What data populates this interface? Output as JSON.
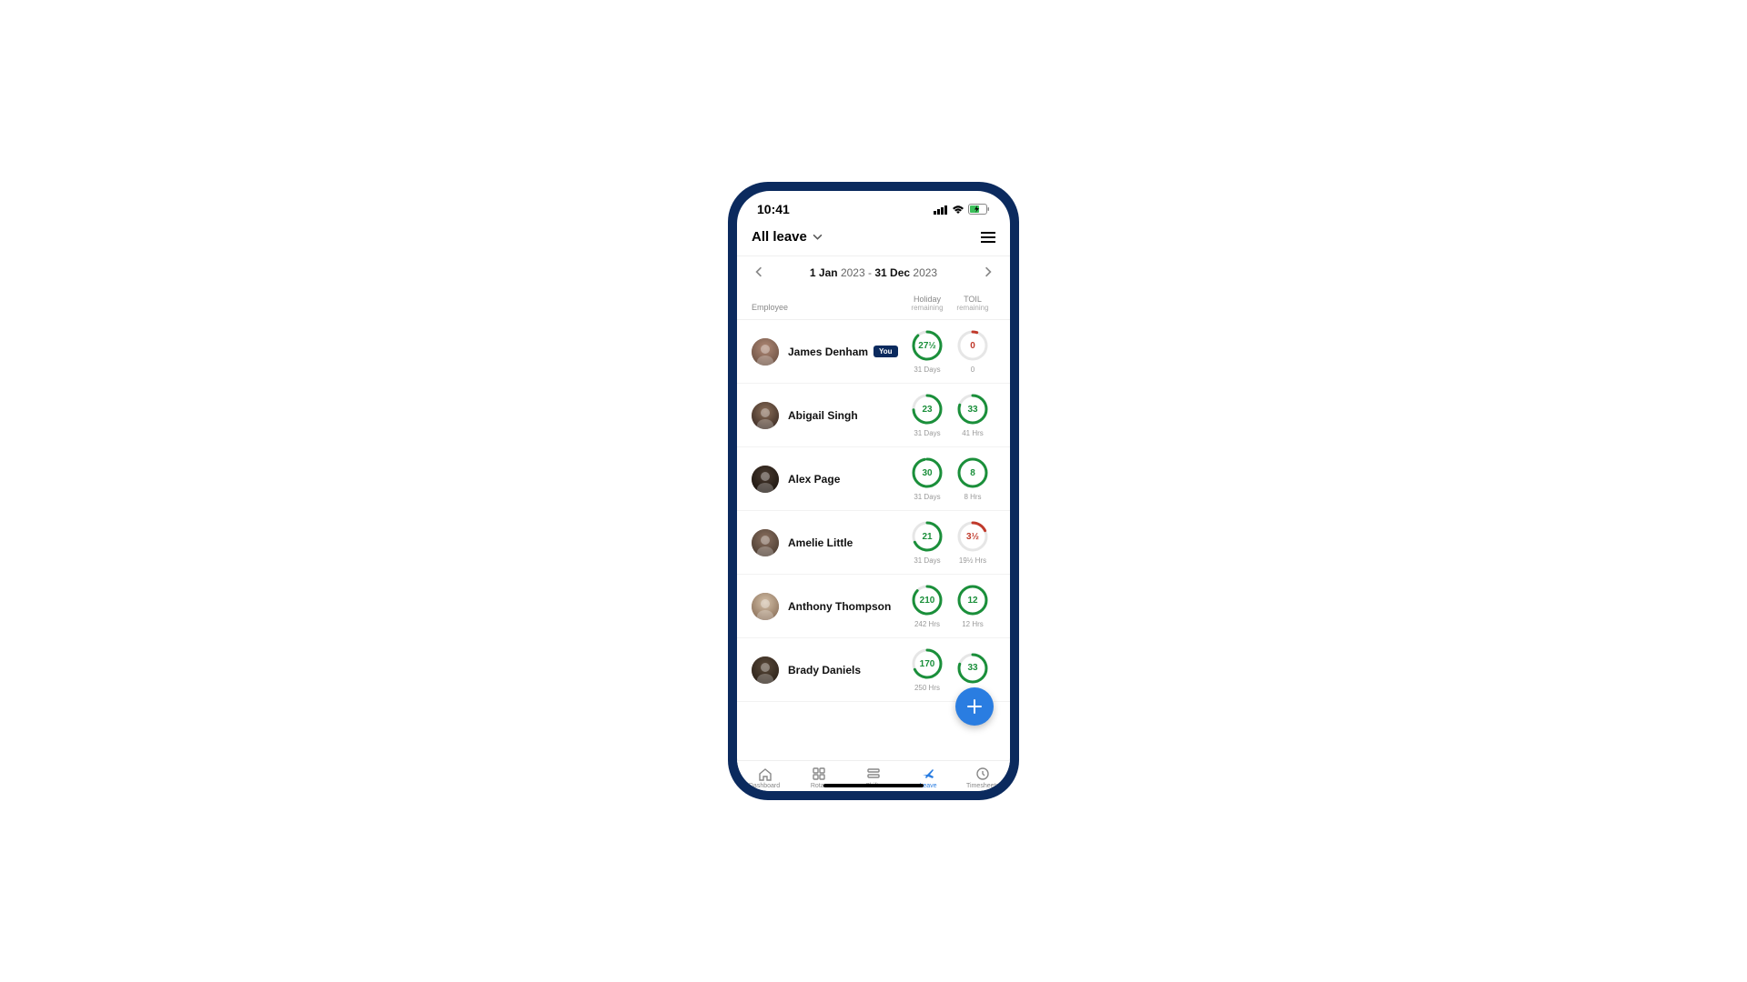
{
  "status": {
    "time": "10:41"
  },
  "header": {
    "title": "All leave"
  },
  "dateRange": {
    "d1": "1",
    "m1": "Jan",
    "y1": "2023",
    "sep": "-",
    "d2": "31",
    "m2": "Dec",
    "y2": "2023"
  },
  "columns": {
    "employee": "Employee",
    "holiday": "Holiday",
    "holidaySub": "remaining",
    "toil": "TOIL",
    "toilSub": "remaining"
  },
  "youBadge": "You",
  "employees": [
    {
      "name": "James Denham",
      "you": true,
      "holidayValue": "27½",
      "holidayTotal": "31 Days",
      "holidayPct": 88,
      "toilValue": "0",
      "toilTotal": "0",
      "toilPct": 5,
      "toilColor": "red"
    },
    {
      "name": "Abigail Singh",
      "you": false,
      "holidayValue": "23",
      "holidayTotal": "31 Days",
      "holidayPct": 74,
      "toilValue": "33",
      "toilTotal": "41 Hrs",
      "toilPct": 80,
      "toilColor": "green"
    },
    {
      "name": "Alex Page",
      "you": false,
      "holidayValue": "30",
      "holidayTotal": "31 Days",
      "holidayPct": 97,
      "toilValue": "8",
      "toilTotal": "8 Hrs",
      "toilPct": 100,
      "toilColor": "green"
    },
    {
      "name": "Amelie Little",
      "you": false,
      "holidayValue": "21",
      "holidayTotal": "31 Days",
      "holidayPct": 68,
      "toilValue": "3½",
      "toilTotal": "19½ Hrs",
      "toilPct": 18,
      "toilColor": "red"
    },
    {
      "name": "Anthony Thompson",
      "you": false,
      "holidayValue": "210",
      "holidayTotal": "242 Hrs",
      "holidayPct": 87,
      "toilValue": "12",
      "toilTotal": "12 Hrs",
      "toilPct": 100,
      "toilColor": "green"
    },
    {
      "name": "Brady Daniels",
      "you": false,
      "holidayValue": "170",
      "holidayTotal": "250 Hrs",
      "holidayPct": 68,
      "toilValue": "33",
      "toilTotal": "",
      "toilPct": 80,
      "toilColor": "green"
    }
  ],
  "tabs": [
    {
      "label": "Dashboard",
      "active": false
    },
    {
      "label": "Rotas",
      "active": false
    },
    {
      "label": "Shifts",
      "active": false
    },
    {
      "label": "Leave",
      "active": true
    },
    {
      "label": "Timesheets",
      "active": false
    }
  ],
  "avatarGradients": [
    [
      "#b08976",
      "#6b5042"
    ],
    [
      "#8b6f5a",
      "#3a2a22"
    ],
    [
      "#4a3b30",
      "#1a130e"
    ],
    [
      "#8a7060",
      "#4a3b30"
    ],
    [
      "#d4c0a8",
      "#8a6f58"
    ],
    [
      "#5a4a3a",
      "#2a2018"
    ]
  ]
}
